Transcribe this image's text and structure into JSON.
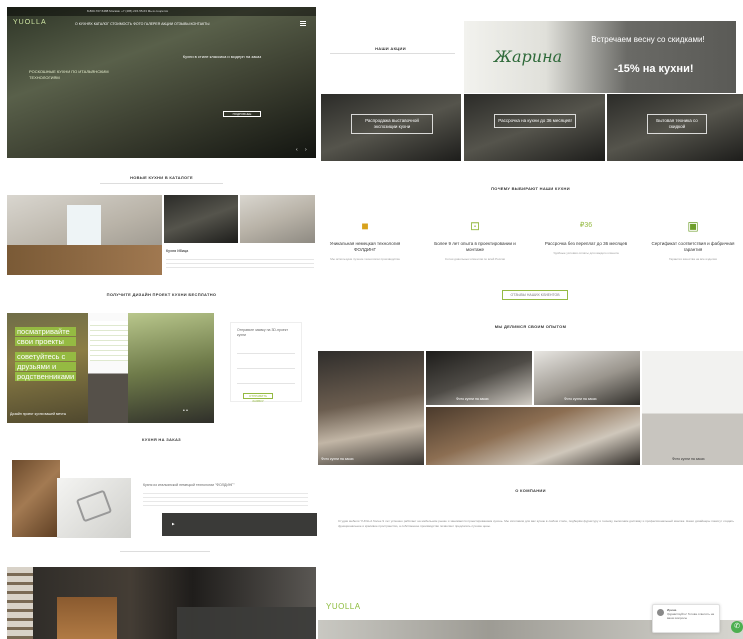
{
  "header": {
    "logo": "YUOLLA",
    "topbar": "8-800-707-5488   Москва: +7 (495) 215-55-63   Мы в соцсетях",
    "menu": "О КУХНЯХ   КАТАЛОГ   СТОИМОСТЬ   ФОТО   ГАЛЕРЕЯ   АКЦИИ   ОТЗЫВЫ   КОНТАКТЫ",
    "hero_left": "РОСКОШНЫЕ КУХНИ ПО ИТАЛЬЯНСКИМ ТЕХНОЛОГИЯМ",
    "hero_right": "Кухни в стиле классика и модерн на заказ",
    "hero_btn": "ПОДРОБНЕЕ"
  },
  "sections": {
    "new_catalog": "НОВЫЕ КУХНИ В КАТАЛОГЕ",
    "design": "ПОЛУЧИТЕ ДИЗАЙН ПРОЕКТ КУХНИ БЕСПЛАТНО",
    "order": "КУХНЯ НА ЗАКАЗ",
    "promos": "НАШИ АКЦИИ",
    "why": "ПОЧЕМУ ВЫБИРАЮТ НАШИ КУХНИ",
    "experience": "МЫ ДЕЛИМСЯ СВОИМ ОПЫТОМ",
    "about": "О КОМПАНИИ"
  },
  "design_promo": {
    "l1": "посматривайте",
    "l2": "свои проекты",
    "l3": "советуйтесь с",
    "l4": "друзьями и",
    "l5": "родственниками",
    "caption": "Дизайн проект кухни вашей мечты"
  },
  "form": {
    "title": "Отправьте заявку на 3D-проект кухни",
    "btn": "ОТПРАВИТЬ ЗАЯВКУ"
  },
  "catalog_caption": "Кухня Ибица",
  "order_caption": "Кухня из итальянской немецкой технологии \"ФОЛДИНГ\"",
  "promo": {
    "script": "Жарина",
    "headline": "Встречаем весну со скидками!",
    "percent": "-15% на кухни!",
    "box1": "Распродажа выставочной экспозиции кухни",
    "box2": "Рассрочка на кухни до 36 месяцев!",
    "box3": "Бытовая техника со скидкой"
  },
  "advantages": [
    {
      "icon": "briefcase-icon",
      "title": "Уникальная немецкая технология ФОЛДИНГ",
      "desc": "Мы используем лучшие технологии производства"
    },
    {
      "icon": "ruler-icon",
      "title": "Более 9 лет опыта в проектировании и монтаже",
      "desc": "Сотни довольных клиентов по всей России"
    },
    {
      "icon": "percent-icon",
      "title": "Рассрочка без переплат до 36 месяцев",
      "desc": "Удобные условия оплаты для каждого клиента"
    },
    {
      "icon": "certificate-icon",
      "title": "Сертификат соответствия и фабричная гарантия",
      "desc": "Гарантия качества на все изделия"
    }
  ],
  "all_reviews_btn": "ОТЗЫВЫ НАШИХ КЛИЕНТОВ",
  "experience_captions": [
    "Фото кухни на заказ",
    "Фото кухни на заказ",
    "Фото кухни на заказ",
    "Фото кухни на заказ"
  ],
  "about_text": "Студия мебели YUOLLA более 9 лет успешно работает на мебельном рынке и занимается проектированием кухонь. Мы изготовим для вас кухню в любом стиле, подберём фурнитуру и технику, выполним доставку и профессиональный монтаж. Наши дизайнеры помогут создать функциональное и красивое пространство, а собственное производство позволяет предлагать лучшие цены.",
  "footer_logo": "YUOLLA",
  "chat": {
    "name": "Ирина",
    "text": "Здравствуйте! Готова ответить на ваши вопросы"
  },
  "colors": {
    "accent": "#95ba42",
    "dark": "#333333"
  }
}
